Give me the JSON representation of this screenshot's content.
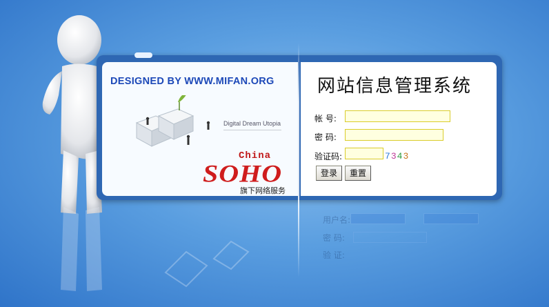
{
  "banner": {
    "designer": "DESIGNED BY WWW.MIFAN.ORG",
    "tagline": "Digital Dream Utopia",
    "brand_top": "China",
    "brand_main": "SOHO",
    "brand_sub": "旗下网络服务"
  },
  "login": {
    "title": "网站信息管理系统",
    "account_label": "帐  号:",
    "password_label": "密  码:",
    "captcha_label": "验证码:",
    "account_value": "",
    "password_value": "",
    "captcha_value": "",
    "captcha_code": "7343",
    "login_button": "登录",
    "reset_button": "重置"
  },
  "reflection": {
    "username_label": "用户名:",
    "password_label": "密  码:",
    "captcha_label": "验  证:"
  },
  "colors": {
    "background": "#4f92dc",
    "frame": "#2e67b3",
    "input_border": "#d9cc2a",
    "brand_red": "#cf1d1d",
    "designer_blue": "#1d49b8"
  }
}
